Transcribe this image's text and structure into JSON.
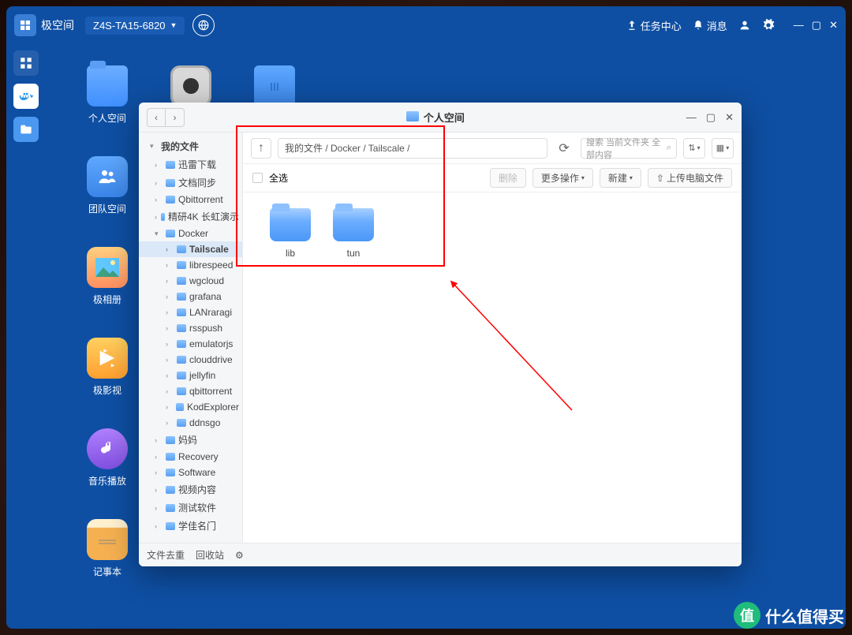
{
  "brand": "极空间",
  "device": "Z4S-TA15-6820",
  "top_icons": {
    "tasks": "任务中心",
    "notifications": "消息"
  },
  "desktop_apps": {
    "personal_space": "个人空间",
    "safe": "",
    "trash": "",
    "team_space": "团队空间",
    "album": "极相册",
    "video": "极影视",
    "music": "音乐播放",
    "notes": "记事本"
  },
  "fm": {
    "title": "个人空间",
    "path": "我的文件 / Docker / Tailscale /",
    "search_placeholder": "搜索 当前文件夹 全部内容",
    "select_all": "全选",
    "buttons": {
      "delete": "删除",
      "more": "更多操作",
      "new": "新建",
      "upload": "上传电脑文件"
    },
    "footer": {
      "dedup": "文件去重",
      "recycle": "回收站"
    },
    "tree": {
      "root": "我的文件",
      "items": [
        {
          "label": "迅雷下载",
          "level": 1
        },
        {
          "label": "文档同步",
          "level": 1
        },
        {
          "label": "Qbittorrent",
          "level": 1
        },
        {
          "label": "精研4K 长虹演示",
          "level": 1
        },
        {
          "label": "Docker",
          "level": 1,
          "expanded": true
        },
        {
          "label": "Tailscale",
          "level": 2,
          "selected": true
        },
        {
          "label": "librespeed",
          "level": 2
        },
        {
          "label": "wgcloud",
          "level": 2
        },
        {
          "label": "grafana",
          "level": 2
        },
        {
          "label": "LANraragi",
          "level": 2
        },
        {
          "label": "rsspush",
          "level": 2
        },
        {
          "label": "emulatorjs",
          "level": 2
        },
        {
          "label": "clouddrive",
          "level": 2
        },
        {
          "label": "jellyfin",
          "level": 2
        },
        {
          "label": "qbittorrent",
          "level": 2
        },
        {
          "label": "KodExplorer",
          "level": 2
        },
        {
          "label": "ddnsgo",
          "level": 2
        },
        {
          "label": "妈妈",
          "level": 1
        },
        {
          "label": "Recovery",
          "level": 1
        },
        {
          "label": "Software",
          "level": 1
        },
        {
          "label": "视频内容",
          "level": 1
        },
        {
          "label": "测试软件",
          "level": 1
        },
        {
          "label": "学佳名门",
          "level": 1
        }
      ]
    },
    "files": [
      {
        "name": "lib",
        "type": "folder"
      },
      {
        "name": "tun",
        "type": "folder"
      }
    ]
  },
  "watermark": "什么值得买"
}
